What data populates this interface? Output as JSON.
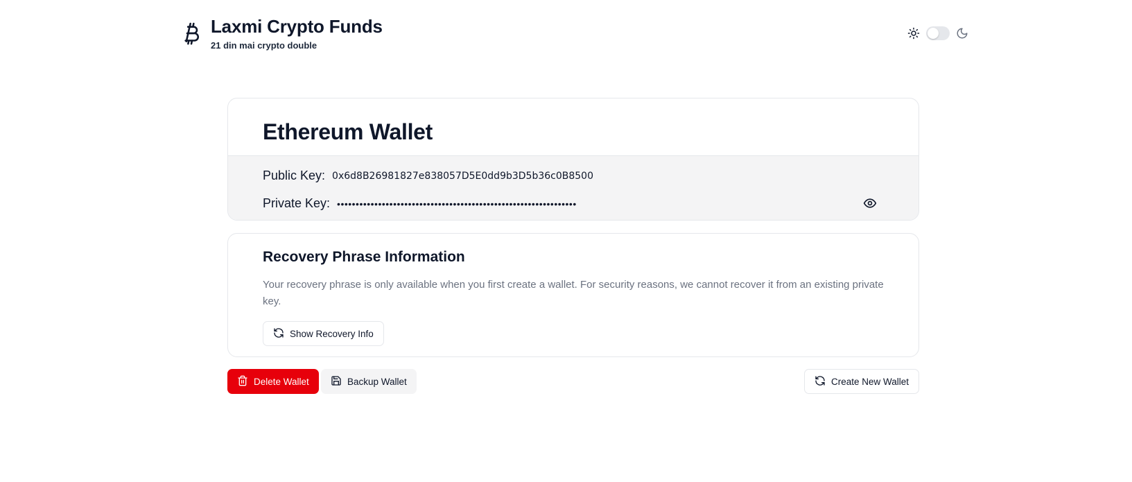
{
  "header": {
    "title": "Laxmi Crypto Funds",
    "subtitle": "21 din mai crypto double",
    "logo_icon": "bitcoin-icon",
    "theme": {
      "light_icon": "sun-icon",
      "dark_icon": "moon-icon",
      "mode": "light"
    }
  },
  "wallet": {
    "title": "Ethereum Wallet",
    "public_key_label": "Public Key:",
    "public_key": "0x6d8B26981827e838057D5E0dd9b3D5b36c0B8500",
    "private_key_label": "Private Key:",
    "private_key_masked": "••••••••••••••••••••••••••••••••••••••••••••••••••••••••••••••••",
    "reveal_icon": "eye-icon"
  },
  "recovery": {
    "title": "Recovery Phrase Information",
    "description": "Your recovery phrase is only available when you first create a wallet. For security reasons, we cannot recover it from an existing private key.",
    "button_label": "Show Recovery Info"
  },
  "actions": {
    "delete_label": "Delete Wallet",
    "backup_label": "Backup Wallet",
    "create_label": "Create New Wallet"
  },
  "colors": {
    "danger": "#e7000b",
    "text": "#0f172a",
    "muted": "#6b7280",
    "panel": "#f4f4f5",
    "border": "#e5e7eb"
  }
}
